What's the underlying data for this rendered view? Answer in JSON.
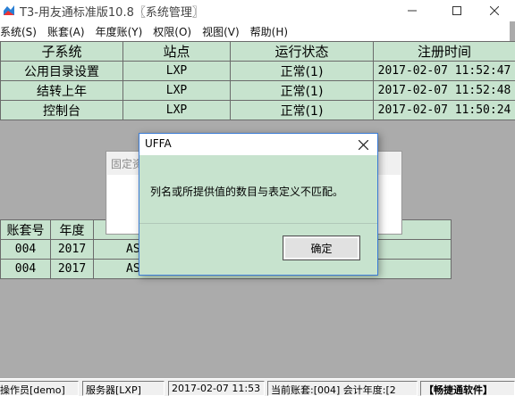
{
  "window": {
    "title": "T3-用友通标准版10.8〖系统管理〗"
  },
  "menu": [
    "系统(S)",
    "账套(A)",
    "年度账(Y)",
    "权限(O)",
    "视图(V)",
    "帮助(H)"
  ],
  "subsystem_table": {
    "headers": [
      "子系统",
      "站点",
      "运行状态",
      "注册时间"
    ],
    "rows": [
      [
        "公用目录设置",
        "LXP",
        "正常(1)",
        "2017-02-07 11:52:47"
      ],
      [
        "结转上年",
        "LXP",
        "正常(1)",
        "2017-02-07 11:52:48"
      ],
      [
        "控制台",
        "LXP",
        "正常(1)",
        "2017-02-07 11:50:24"
      ]
    ]
  },
  "background_dialog": {
    "title": "固定资"
  },
  "account_table": {
    "headers": [
      "账套号",
      "年度",
      ""
    ],
    "rows": [
      [
        "004",
        "2017",
        "AS"
      ],
      [
        "004",
        "2017",
        "AS"
      ]
    ]
  },
  "message_box": {
    "title": "UFFA",
    "message": "列名或所提供值的数目与表定义不匹配。",
    "ok_label": "确定"
  },
  "status_bar": {
    "operator": "操作员[demo]",
    "server": "服务器[LXP]",
    "datetime": "2017-02-07 11:53",
    "current_account": "当前账套:[004] 会计年度:[2",
    "brand": "【畅捷通软件】"
  },
  "colors": {
    "grid_green": "#c7e3ce",
    "workspace_gray": "#ababab",
    "dialog_border": "#3a7bd5"
  }
}
